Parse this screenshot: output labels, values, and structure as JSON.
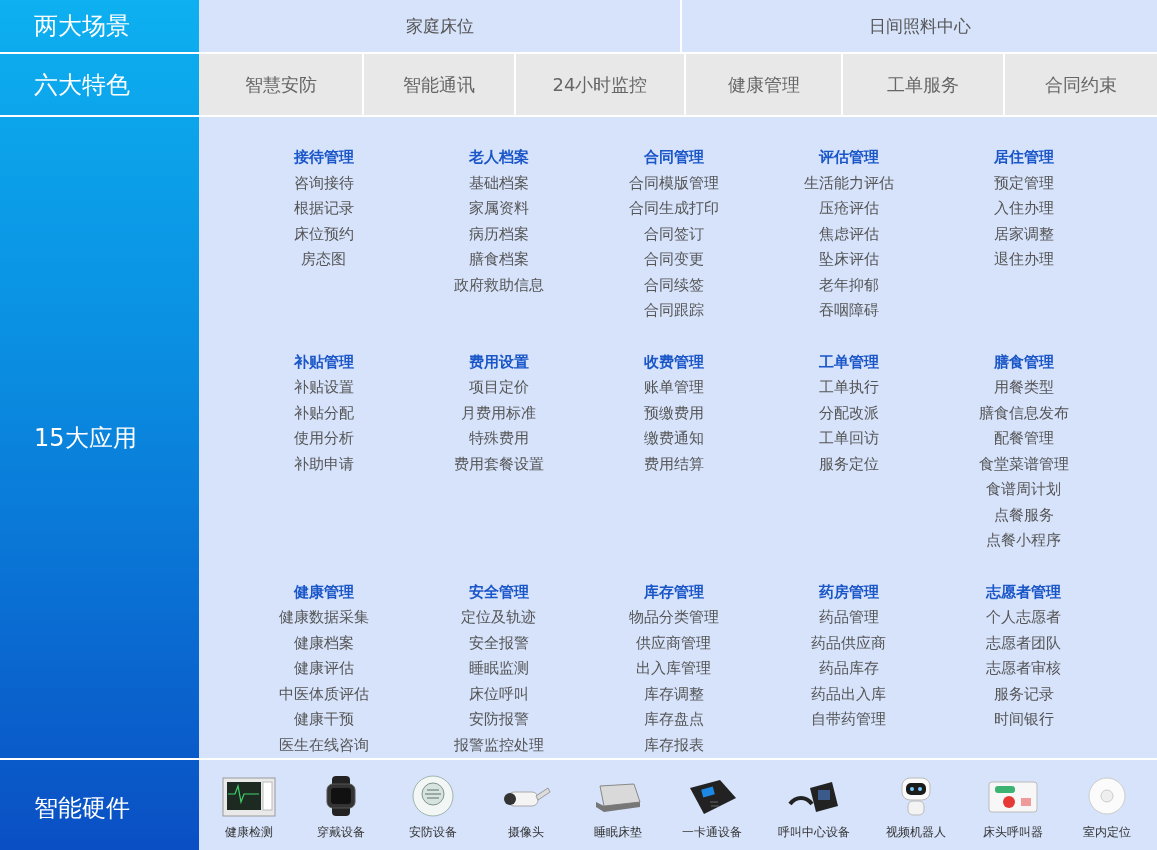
{
  "scenes": {
    "label": "两大场景",
    "items": [
      "家庭床位",
      "日间照料中心"
    ]
  },
  "features": {
    "label": "六大特色",
    "items": [
      "智慧安防",
      "智能通讯",
      "24小时监控",
      "健康管理",
      "工单服务",
      "合同约束"
    ]
  },
  "applications": {
    "label": "15大应用",
    "groups": [
      {
        "title": "接待管理",
        "items": [
          "咨询接待",
          "根据记录",
          "床位预约",
          "房态图"
        ]
      },
      {
        "title": "老人档案",
        "items": [
          "基础档案",
          "家属资料",
          "病历档案",
          "膳食档案",
          "政府救助信息"
        ]
      },
      {
        "title": "合同管理",
        "items": [
          "合同模版管理",
          "合同生成打印",
          "合同签订",
          "合同变更",
          "合同续签",
          "合同跟踪"
        ]
      },
      {
        "title": "评估管理",
        "items": [
          "生活能力评估",
          "压疮评估",
          "焦虑评估",
          "坠床评估",
          "老年抑郁",
          "吞咽障碍"
        ]
      },
      {
        "title": "居住管理",
        "items": [
          "预定管理",
          "入住办理",
          "居家调整",
          "退住办理"
        ]
      },
      {
        "title": "补贴管理",
        "items": [
          "补贴设置",
          "补贴分配",
          "使用分析",
          "补助申请"
        ]
      },
      {
        "title": "费用设置",
        "items": [
          "项目定价",
          "月费用标准",
          "特殊费用",
          "费用套餐设置"
        ]
      },
      {
        "title": "收费管理",
        "items": [
          "账单管理",
          "预缴费用",
          "缴费通知",
          "费用结算"
        ]
      },
      {
        "title": "工单管理",
        "items": [
          "工单执行",
          "分配改派",
          "工单回访",
          "服务定位"
        ]
      },
      {
        "title": "膳食管理",
        "items": [
          "用餐类型",
          "膳食信息发布",
          "配餐管理",
          "食堂菜谱管理",
          "食谱周计划",
          "点餐服务",
          "点餐小程序"
        ]
      },
      {
        "title": "健康管理",
        "items": [
          "健康数据采集",
          "健康档案",
          "健康评估",
          "中医体质评估",
          "健康干预",
          "医生在线咨询"
        ]
      },
      {
        "title": "安全管理",
        "items": [
          "定位及轨迹",
          "安全报警",
          "睡眠监测",
          "床位呼叫",
          "安防报警",
          "报警监控处理"
        ]
      },
      {
        "title": "库存管理",
        "items": [
          "物品分类管理",
          "供应商管理",
          "出入库管理",
          "库存调整",
          "库存盘点",
          "库存报表"
        ]
      },
      {
        "title": "药房管理",
        "items": [
          "药品管理",
          "药品供应商",
          "药品库存",
          "药品出入库",
          "自带药管理"
        ]
      },
      {
        "title": "志愿者管理",
        "items": [
          "个人志愿者",
          "志愿者团队",
          "志愿者审核",
          "服务记录",
          "时间银行"
        ]
      }
    ]
  },
  "hardware": {
    "label": "智能硬件",
    "items": [
      "健康检测",
      "穿戴设备",
      "安防设备",
      "摄像头",
      "睡眠床垫",
      "一卡通设备",
      "呼叫中心设备",
      "视频机器人",
      "床头呼叫器",
      "室内定位"
    ]
  }
}
